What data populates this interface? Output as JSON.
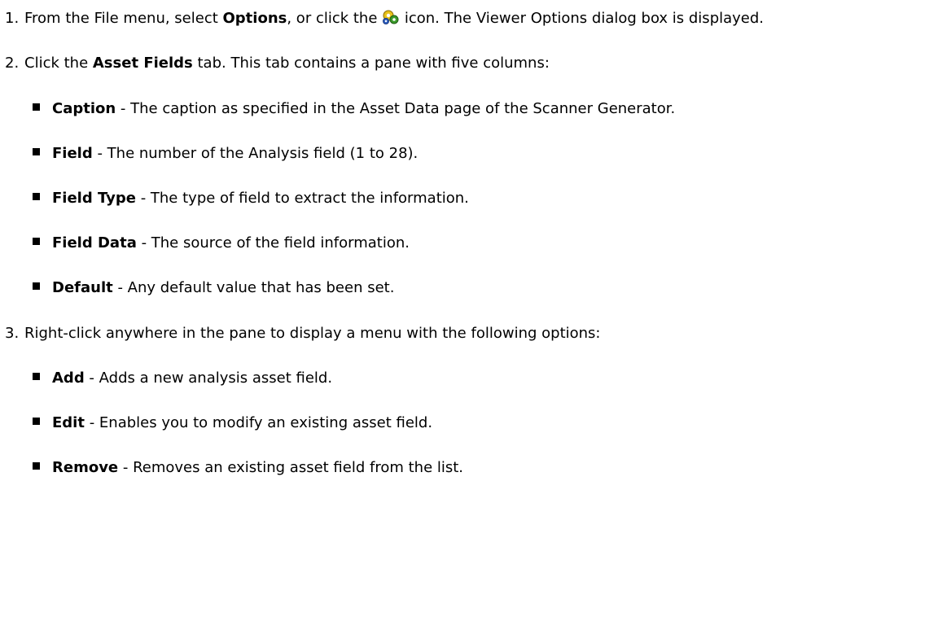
{
  "steps": [
    {
      "number": "1.",
      "pre": "From the File menu, select ",
      "bold": "Options",
      "mid": ", or click the ",
      "icon": "options-gear-icon",
      "post": " icon. The Viewer Options dialog box is displayed."
    },
    {
      "number": "2.",
      "pre": "Click the ",
      "bold": "Asset Fields",
      "post": " tab. This tab contains a pane with five columns:",
      "bullets": [
        {
          "term": "Caption",
          "desc": " - The caption as specified in the Asset Data page of the Scanner Generator."
        },
        {
          "term": "Field",
          "desc": " - The number of the Analysis field (1 to 28)."
        },
        {
          "term": "Field Type",
          "desc": " - The type of field to extract the information."
        },
        {
          "term": "Field Data",
          "desc": " - The source of the field information."
        },
        {
          "term": "Default",
          "desc": " - Any default value that has been set."
        }
      ]
    },
    {
      "number": "3.",
      "text": "Right-click anywhere in the pane to display a menu with the following options:",
      "bullets": [
        {
          "term": "Add",
          "desc": " - Adds a new analysis asset field."
        },
        {
          "term": "Edit",
          "desc": " - Enables you to modify an existing asset field."
        },
        {
          "term": "Remove",
          "desc": " - Removes an existing asset field from the list."
        }
      ]
    }
  ],
  "colors": {
    "text": "#000000",
    "background": "#ffffff",
    "gear_yellow": "#e8c21a",
    "gear_green": "#3a9a2a",
    "gear_blue": "#3060c0"
  }
}
